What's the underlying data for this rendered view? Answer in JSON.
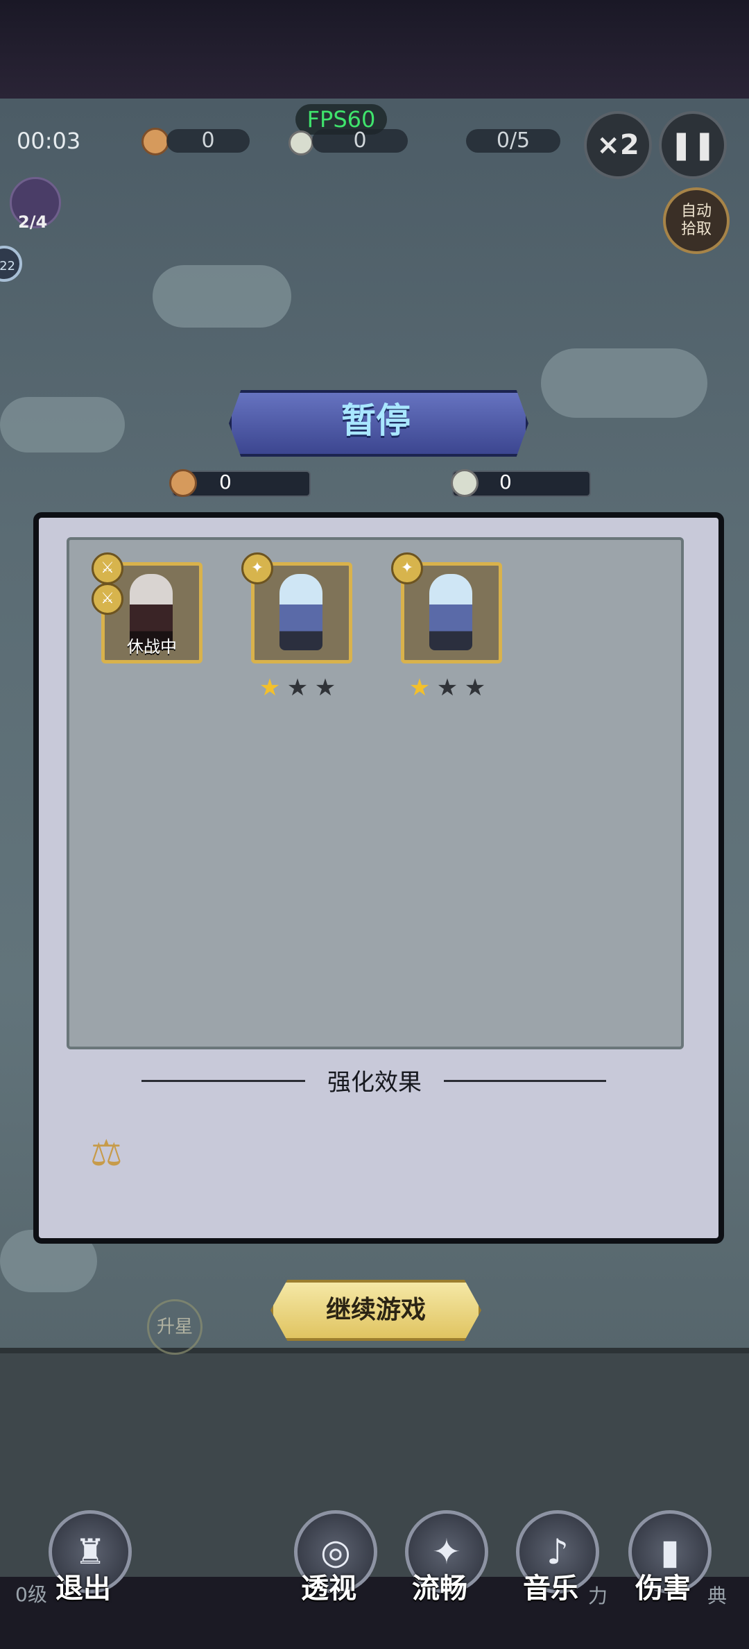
{
  "hud": {
    "timer": "00:03",
    "fps": "FPS60",
    "coins": "0",
    "kills": "0",
    "boss_progress": "0/5",
    "speed": "×2",
    "enemy_wave": "2/4",
    "side_badge": "22",
    "auto_pick_line1": "自动",
    "auto_pick_line2": "拾取"
  },
  "pause": {
    "title": "暂停",
    "coin_value": "0",
    "kill_value": "0"
  },
  "heroes": [
    {
      "status": "休战中",
      "stars": 0
    },
    {
      "status": "",
      "stars": 1
    },
    {
      "status": "",
      "stars": 1
    }
  ],
  "enhance": {
    "title": "强化效果"
  },
  "continue_label": "继续游戏",
  "scene": {
    "upgrade_label": "升星",
    "level_text": "0级",
    "power_text": "力",
    "codex_text": "典"
  },
  "menu": {
    "exit": "退出",
    "perspective": "透视",
    "smooth": "流畅",
    "music": "音乐",
    "damage": "伤害"
  },
  "colors": {
    "panel_bg": "#c8c9d9",
    "grid_bg": "#9ca4aa",
    "accent_gold": "#d9b24c",
    "fps_green": "#3fe46c",
    "banner_blue": "#4c57a8"
  }
}
